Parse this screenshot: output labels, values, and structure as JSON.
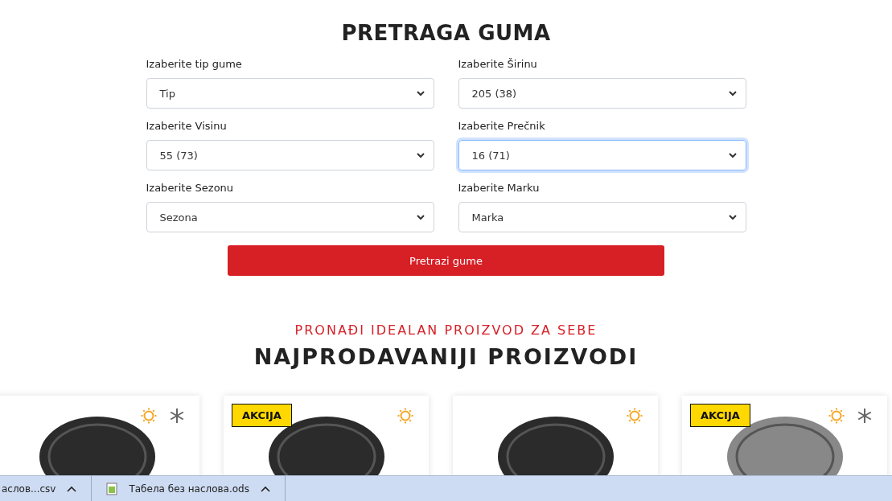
{
  "search": {
    "title": "PRETRAGA GUMA",
    "fields": [
      {
        "label": "Izaberite tip gume",
        "value": "Tip",
        "focused": false
      },
      {
        "label": "Izaberite Širinu",
        "value": "205 (38)",
        "focused": false
      },
      {
        "label": "Izaberite Visinu",
        "value": "55 (73)",
        "focused": false
      },
      {
        "label": "Izaberite Prečnik",
        "value": "16 (71)",
        "focused": true
      },
      {
        "label": "Izaberite Sezonu",
        "value": "Sezona",
        "focused": false
      },
      {
        "label": "Izaberite Marku",
        "value": "Marka",
        "focused": false
      }
    ],
    "button": "Pretrazi gume"
  },
  "products": {
    "subtitle": "PRONAĐI IDEALAN PROIZVOD ZA SEBE",
    "title": "NAJPRODAVANIJI PROIZVODI",
    "items": [
      {
        "sale": false,
        "summer": true,
        "winter": true
      },
      {
        "sale": true,
        "badge": "AKCIJA",
        "summer": true,
        "winter": false
      },
      {
        "sale": false,
        "summer": true,
        "winter": false
      },
      {
        "sale": true,
        "badge": "AKCIJA",
        "summer": true,
        "winter": true
      }
    ]
  },
  "download_bar": {
    "items": [
      "аслов...csv",
      "Табела без наслова.ods"
    ]
  }
}
